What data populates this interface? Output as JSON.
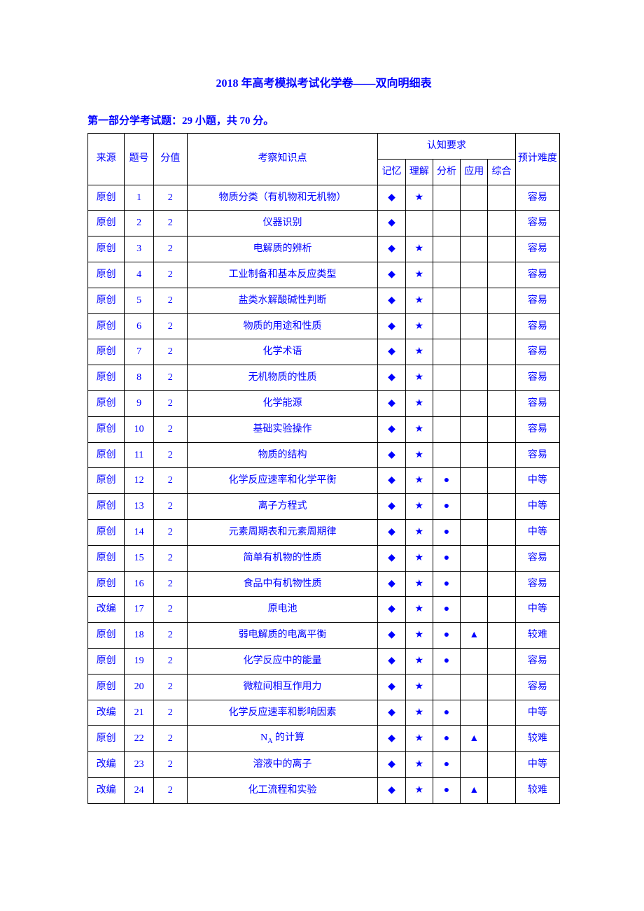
{
  "title": "2018 年高考模拟考试化学卷——双向明细表",
  "section_heading": "第一部分学考试题：29 小题，共 70 分。",
  "headers": {
    "source": "来源",
    "number": "题号",
    "score": "分值",
    "topic": "考察知识点",
    "cognition": "认知要求",
    "cog_memory": "记忆",
    "cog_understand": "理解",
    "cog_analyze": "分析",
    "cog_apply": "应用",
    "cog_synth": "综合",
    "difficulty": "预计难度"
  },
  "symbols": {
    "diamond": "◆",
    "star": "★",
    "circle": "●",
    "triangle": "▲"
  },
  "rows": [
    {
      "source": "原创",
      "num": "1",
      "score": "2",
      "topic": "物质分类（有机物和无机物）",
      "mem": true,
      "und": true,
      "ana": false,
      "app": false,
      "syn": false,
      "diff": "容易"
    },
    {
      "source": "原创",
      "num": "2",
      "score": "2",
      "topic": "仪器识别",
      "mem": true,
      "und": false,
      "ana": false,
      "app": false,
      "syn": false,
      "diff": "容易"
    },
    {
      "source": "原创",
      "num": "3",
      "score": "2",
      "topic": "电解质的辨析",
      "mem": true,
      "und": true,
      "ana": false,
      "app": false,
      "syn": false,
      "diff": "容易"
    },
    {
      "source": "原创",
      "num": "4",
      "score": "2",
      "topic": "工业制备和基本反应类型",
      "mem": true,
      "und": true,
      "ana": false,
      "app": false,
      "syn": false,
      "diff": "容易"
    },
    {
      "source": "原创",
      "num": "5",
      "score": "2",
      "topic": "盐类水解酸碱性判断",
      "mem": true,
      "und": true,
      "ana": false,
      "app": false,
      "syn": false,
      "diff": "容易"
    },
    {
      "source": "原创",
      "num": "6",
      "score": "2",
      "topic": "物质的用途和性质",
      "mem": true,
      "und": true,
      "ana": false,
      "app": false,
      "syn": false,
      "diff": "容易"
    },
    {
      "source": "原创",
      "num": "7",
      "score": "2",
      "topic": "化学术语",
      "mem": true,
      "und": true,
      "ana": false,
      "app": false,
      "syn": false,
      "diff": "容易"
    },
    {
      "source": "原创",
      "num": "8",
      "score": "2",
      "topic": "无机物质的性质",
      "mem": true,
      "und": true,
      "ana": false,
      "app": false,
      "syn": false,
      "diff": "容易"
    },
    {
      "source": "原创",
      "num": "9",
      "score": "2",
      "topic": "化学能源",
      "mem": true,
      "und": true,
      "ana": false,
      "app": false,
      "syn": false,
      "diff": "容易"
    },
    {
      "source": "原创",
      "num": "10",
      "score": "2",
      "topic": "基础实验操作",
      "mem": true,
      "und": true,
      "ana": false,
      "app": false,
      "syn": false,
      "diff": "容易"
    },
    {
      "source": "原创",
      "num": "11",
      "score": "2",
      "topic": "物质的结构",
      "mem": true,
      "und": true,
      "ana": false,
      "app": false,
      "syn": false,
      "diff": "容易"
    },
    {
      "source": "原创",
      "num": "12",
      "score": "2",
      "topic": "化学反应速率和化学平衡",
      "mem": true,
      "und": true,
      "ana": true,
      "app": false,
      "syn": false,
      "diff": "中等"
    },
    {
      "source": "原创",
      "num": "13",
      "score": "2",
      "topic": "离子方程式",
      "mem": true,
      "und": true,
      "ana": true,
      "app": false,
      "syn": false,
      "diff": "中等"
    },
    {
      "source": "原创",
      "num": "14",
      "score": "2",
      "topic": "元素周期表和元素周期律",
      "mem": true,
      "und": true,
      "ana": true,
      "app": false,
      "syn": false,
      "diff": "中等"
    },
    {
      "source": "原创",
      "num": "15",
      "score": "2",
      "topic": "简单有机物的性质",
      "mem": true,
      "und": true,
      "ana": true,
      "app": false,
      "syn": false,
      "diff": "容易"
    },
    {
      "source": "原创",
      "num": "16",
      "score": "2",
      "topic": "食品中有机物性质",
      "mem": true,
      "und": true,
      "ana": true,
      "app": false,
      "syn": false,
      "diff": "容易"
    },
    {
      "source": "改编",
      "num": "17",
      "score": "2",
      "topic": "原电池",
      "mem": true,
      "und": true,
      "ana": true,
      "app": false,
      "syn": false,
      "diff": "中等"
    },
    {
      "source": "原创",
      "num": "18",
      "score": "2",
      "topic": "弱电解质的电离平衡",
      "mem": true,
      "und": true,
      "ana": true,
      "app": true,
      "syn": false,
      "diff": "较难"
    },
    {
      "source": "原创",
      "num": "19",
      "score": "2",
      "topic": "化学反应中的能量",
      "mem": true,
      "und": true,
      "ana": true,
      "app": false,
      "syn": false,
      "diff": "容易"
    },
    {
      "source": "原创",
      "num": "20",
      "score": "2",
      "topic": "微粒间相互作用力",
      "mem": true,
      "und": true,
      "ana": false,
      "app": false,
      "syn": false,
      "diff": "容易"
    },
    {
      "source": "改编",
      "num": "21",
      "score": "2",
      "topic": "化学反应速率和影响因素",
      "mem": true,
      "und": true,
      "ana": true,
      "app": false,
      "syn": false,
      "diff": "中等"
    },
    {
      "source": "原创",
      "num": "22",
      "score": "2",
      "topic": "N<sub>A</sub> 的计算",
      "mem": true,
      "und": true,
      "ana": true,
      "app": true,
      "syn": false,
      "diff": "较难",
      "html": true
    },
    {
      "source": "改编",
      "num": "23",
      "score": "2",
      "topic": "溶液中的离子",
      "mem": true,
      "und": true,
      "ana": true,
      "app": false,
      "syn": false,
      "diff": "中等"
    },
    {
      "source": "改编",
      "num": "24",
      "score": "2",
      "topic": "化工流程和实验",
      "mem": true,
      "und": true,
      "ana": true,
      "app": true,
      "syn": false,
      "diff": "较难"
    }
  ]
}
